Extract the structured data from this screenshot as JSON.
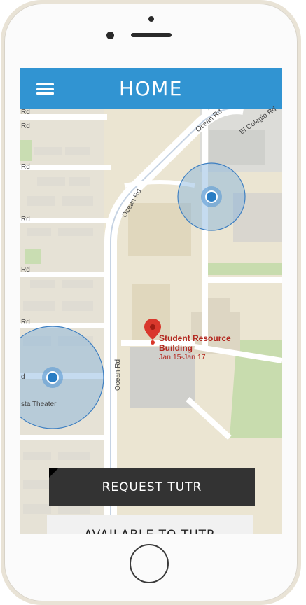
{
  "app_bar": {
    "title": "HOME",
    "menu_icon": "hamburger-menu-icon",
    "color": "#3194d2"
  },
  "map": {
    "road_labels": {
      "rd_1": "Rd",
      "rd_2": "Rd",
      "rd_3": "Rd",
      "rd_4": "Rd",
      "rd_5": "Rd",
      "rd_6": "Rd",
      "rd_7": "d",
      "ocean_rd_1": "Ocean Rd",
      "ocean_rd_2": "Ocean Rd",
      "ocean_rd_3": "Ocean Rd",
      "colegio": "El Colegio Rd",
      "theater": "sta Theater"
    },
    "poi": {
      "name_line1": "Student Resource",
      "name_line2": "Building",
      "dates": "Jan 15-Jan 17"
    },
    "markers": {
      "pin_icon": "map-pin-icon",
      "location_icon": "location-dot-icon"
    }
  },
  "actions": {
    "request_label": "REQUEST TUTR",
    "available_label": "AVAILABLE TO TUTR"
  }
}
